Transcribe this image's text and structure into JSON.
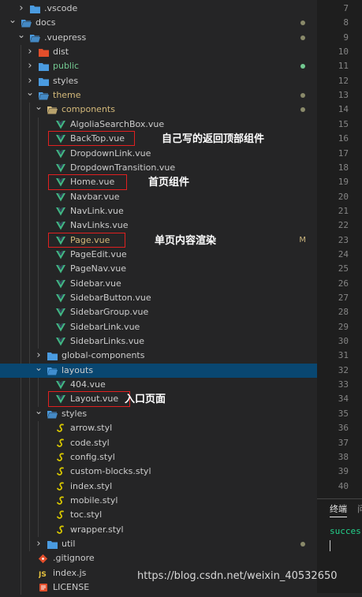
{
  "colors": {
    "folder_blue": "#4a9be0",
    "vue_green": "#41b883",
    "styl_yellow": "#d7c600",
    "git_orange": "#e24e2b",
    "js_yellow": "#e8c33f",
    "modified_badge": "#c9b37c",
    "untracked_green": "#73c991",
    "dot_grey": "#8a8a6a",
    "selection": "#094771",
    "annotation_box": "#e02020"
  },
  "tree": [
    {
      "label": "vscode",
      "prefix": ".",
      "depth": 1,
      "type": "folder",
      "chevron": "right",
      "iconColor": "#4a9be0"
    },
    {
      "label": "docs",
      "depth": 0,
      "type": "folder",
      "chevron": "down",
      "iconColor": "#4a9be0",
      "badge": "dot"
    },
    {
      "label": "vuepress",
      "prefix": ".",
      "depth": 1,
      "type": "folder",
      "chevron": "down",
      "iconColor": "#4a9be0",
      "badge": "dot"
    },
    {
      "label": "dist",
      "depth": 2,
      "type": "folder",
      "chevron": "right",
      "iconColor": "#e24e2b"
    },
    {
      "label": "public",
      "depth": 2,
      "type": "folder",
      "chevron": "right",
      "iconColor": "#4a9be0",
      "textColor": "#73c991",
      "badge": "dot-green"
    },
    {
      "label": "styles",
      "depth": 2,
      "type": "folder",
      "chevron": "right",
      "iconColor": "#4a9be0"
    },
    {
      "label": "theme",
      "depth": 2,
      "type": "folder",
      "chevron": "down",
      "iconColor": "#4a9be0",
      "textColor": "#d4b97a",
      "badge": "dot"
    },
    {
      "label": "components",
      "depth": 3,
      "type": "folder",
      "chevron": "down",
      "iconColor": "#d4b97a",
      "textColor": "#d4b97a",
      "badge": "dot"
    },
    {
      "label": "AlgoliaSearchBox.vue",
      "depth": 4,
      "type": "vue"
    },
    {
      "label": "BackTop.vue",
      "depth": 4,
      "type": "vue"
    },
    {
      "label": "DropdownLink.vue",
      "depth": 4,
      "type": "vue"
    },
    {
      "label": "DropdownTransition.vue",
      "depth": 4,
      "type": "vue"
    },
    {
      "label": "Home.vue",
      "depth": 4,
      "type": "vue"
    },
    {
      "label": "Navbar.vue",
      "depth": 4,
      "type": "vue"
    },
    {
      "label": "NavLink.vue",
      "depth": 4,
      "type": "vue"
    },
    {
      "label": "NavLinks.vue",
      "depth": 4,
      "type": "vue"
    },
    {
      "label": "Page.vue",
      "depth": 4,
      "type": "vue",
      "textColor": "#d4b97a",
      "badge": "M"
    },
    {
      "label": "PageEdit.vue",
      "depth": 4,
      "type": "vue"
    },
    {
      "label": "PageNav.vue",
      "depth": 4,
      "type": "vue"
    },
    {
      "label": "Sidebar.vue",
      "depth": 4,
      "type": "vue"
    },
    {
      "label": "SidebarButton.vue",
      "depth": 4,
      "type": "vue"
    },
    {
      "label": "SidebarGroup.vue",
      "depth": 4,
      "type": "vue"
    },
    {
      "label": "SidebarLink.vue",
      "depth": 4,
      "type": "vue"
    },
    {
      "label": "SidebarLinks.vue",
      "depth": 4,
      "type": "vue"
    },
    {
      "label": "global-components",
      "depth": 3,
      "type": "folder",
      "chevron": "right",
      "iconColor": "#4a9be0"
    },
    {
      "label": "layouts",
      "depth": 3,
      "type": "folder",
      "chevron": "down",
      "iconColor": "#4a9be0",
      "selected": true
    },
    {
      "label": "404.vue",
      "depth": 4,
      "type": "vue"
    },
    {
      "label": "Layout.vue",
      "depth": 4,
      "type": "vue"
    },
    {
      "label": "styles",
      "depth": 3,
      "type": "folder",
      "chevron": "down",
      "iconColor": "#4a9be0"
    },
    {
      "label": "arrow.styl",
      "depth": 4,
      "type": "styl"
    },
    {
      "label": "code.styl",
      "depth": 4,
      "type": "styl"
    },
    {
      "label": "config.styl",
      "depth": 4,
      "type": "styl"
    },
    {
      "label": "custom-blocks.styl",
      "depth": 4,
      "type": "styl"
    },
    {
      "label": "index.styl",
      "depth": 4,
      "type": "styl"
    },
    {
      "label": "mobile.styl",
      "depth": 4,
      "type": "styl"
    },
    {
      "label": "toc.styl",
      "depth": 4,
      "type": "styl"
    },
    {
      "label": "wrapper.styl",
      "depth": 4,
      "type": "styl"
    },
    {
      "label": "util",
      "depth": 3,
      "type": "folder",
      "chevron": "right",
      "iconColor": "#4a9be0",
      "badge": "dot"
    },
    {
      "label": "gitignore",
      "prefix": ".",
      "depth": 2,
      "type": "git"
    },
    {
      "label": "index.js",
      "depth": 2,
      "type": "js"
    },
    {
      "label": "LICENSE",
      "depth": 2,
      "type": "license"
    }
  ],
  "annotations": [
    {
      "text": "自己写的返回顶部组件",
      "row": 9
    },
    {
      "text": "首页组件",
      "row": 12
    },
    {
      "text": "单页内容渲染",
      "row": 16
    },
    {
      "text": "入口页面",
      "row": 27
    }
  ],
  "line_numbers": [
    "7",
    "8",
    "9",
    "10",
    "11",
    "12",
    "13",
    "14",
    "15",
    "16",
    "17",
    "18",
    "19",
    "20",
    "21",
    "22",
    "23",
    "24",
    "25",
    "26",
    "27",
    "28",
    "29",
    "30",
    "31",
    "32",
    "33",
    "34",
    "35",
    "36",
    "37",
    "38",
    "39",
    "40"
  ],
  "panel": {
    "tab_label": "终端",
    "tab_cut": "问",
    "output": "succes"
  },
  "watermark": "https://blog.csdn.net/weixin_40532650"
}
